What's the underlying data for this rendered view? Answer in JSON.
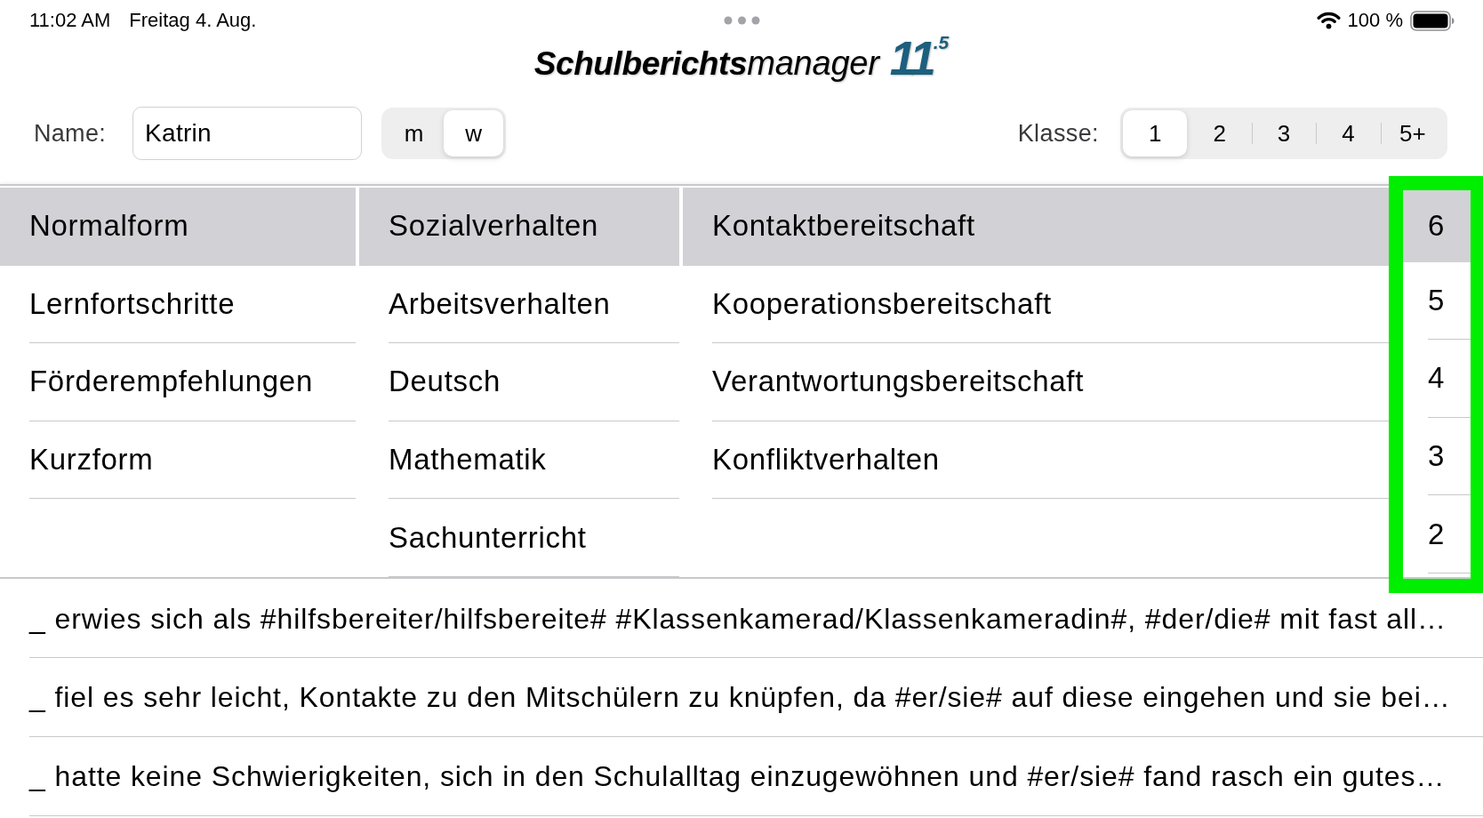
{
  "status_bar": {
    "time": "11:02 AM",
    "date": "Freitag 4. Aug.",
    "battery": "100 %"
  },
  "logo": {
    "name_bold": "Schulberichts",
    "name_light": "manager",
    "version": "11",
    "version_sup": ".5"
  },
  "name_field": {
    "label": "Name:",
    "value": "Katrin"
  },
  "gender_toggle": [
    {
      "label": "m",
      "selected": false
    },
    {
      "label": "w",
      "selected": true
    }
  ],
  "class_picker": {
    "label": "Klasse:",
    "options": [
      {
        "label": "1",
        "selected": true
      },
      {
        "label": "2",
        "selected": false
      },
      {
        "label": "3",
        "selected": false
      },
      {
        "label": "4",
        "selected": false
      },
      {
        "label": "5+",
        "selected": false
      }
    ]
  },
  "columns": [
    {
      "kind": "text",
      "highlighted": false,
      "items": [
        {
          "label": "Normalform",
          "selected": true
        },
        {
          "label": "Lernfortschritte",
          "selected": false
        },
        {
          "label": "Förderempfehlungen",
          "selected": false
        },
        {
          "label": "Kurzform",
          "selected": false
        }
      ]
    },
    {
      "kind": "text",
      "highlighted": false,
      "items": [
        {
          "label": "Sozialverhalten",
          "selected": true
        },
        {
          "label": "Arbeitsverhalten",
          "selected": false
        },
        {
          "label": "Deutsch",
          "selected": false
        },
        {
          "label": "Mathematik",
          "selected": false
        },
        {
          "label": "Sachunterricht",
          "selected": false
        }
      ]
    },
    {
      "kind": "text",
      "highlighted": false,
      "items": [
        {
          "label": "Kontaktbereitschaft",
          "selected": true
        },
        {
          "label": "Kooperationsbereitschaft",
          "selected": false
        },
        {
          "label": "Verantwortungsbereitschaft",
          "selected": false
        },
        {
          "label": "Konfliktverhalten",
          "selected": false
        }
      ]
    },
    {
      "kind": "grade",
      "highlighted": true,
      "items": [
        {
          "label": "6",
          "selected": true
        },
        {
          "label": "5",
          "selected": false
        },
        {
          "label": "4",
          "selected": false
        },
        {
          "label": "3",
          "selected": false
        },
        {
          "label": "2",
          "selected": false
        }
      ]
    }
  ],
  "phrases": [
    "_ erwies sich als #hilfsbereiter/hilfsbereite# #Klassenkamerad/Klassenkameradin#, #der/die# mit fast all…",
    "_ fiel es sehr leicht, Kontakte zu den Mitschülern zu knüpfen, da #er/sie# auf diese eingehen und sie bei…",
    "_ hatte keine Schwierigkeiten, sich in den Schulalltag einzugewöhnen und #er/sie# fand rasch ein gutes…"
  ]
}
